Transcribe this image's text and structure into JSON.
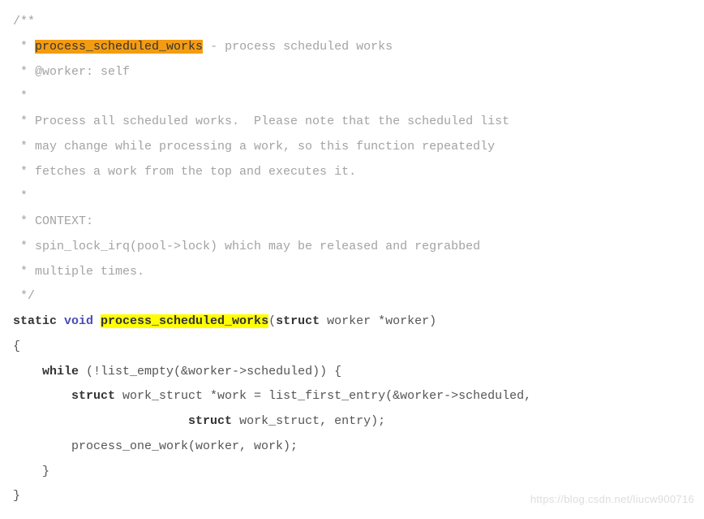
{
  "code": {
    "c01": "/**",
    "c02_pre": " * ",
    "c02_hl": "process_scheduled_works",
    "c02_post": " - process scheduled works",
    "c03": " * @worker: self",
    "c04": " *",
    "c05": " * Process all scheduled works.  Please note that the scheduled list",
    "c06": " * may change while processing a work, so this function repeatedly",
    "c07": " * fetches a work from the top and executes it.",
    "c08": " *",
    "c09": " * CONTEXT:",
    "c10": " * spin_lock_irq(pool->lock) which may be released and regrabbed",
    "c11": " * multiple times.",
    "c12": " */",
    "l01_static": "static",
    "l01_void": " void ",
    "l01_fn": "process_scheduled_works",
    "l01_open": "(",
    "l01_struct": "struct",
    "l01_post": " worker *worker)",
    "l02": "{",
    "l03_pre": "    ",
    "l03_while": "while",
    "l03_post": " (!list_empty(&worker->scheduled)) {",
    "l04_pre": "        ",
    "l04_struct": "struct",
    "l04_post": " work_struct *work = list_first_entry(&worker->scheduled,",
    "l05_pre": "                        ",
    "l05_struct": "struct",
    "l05_post": " work_struct, entry);",
    "l06": "        process_one_work(worker, work);",
    "l07": "    }",
    "l08": "}"
  },
  "watermark": "https://blog.csdn.net/liucw900716"
}
